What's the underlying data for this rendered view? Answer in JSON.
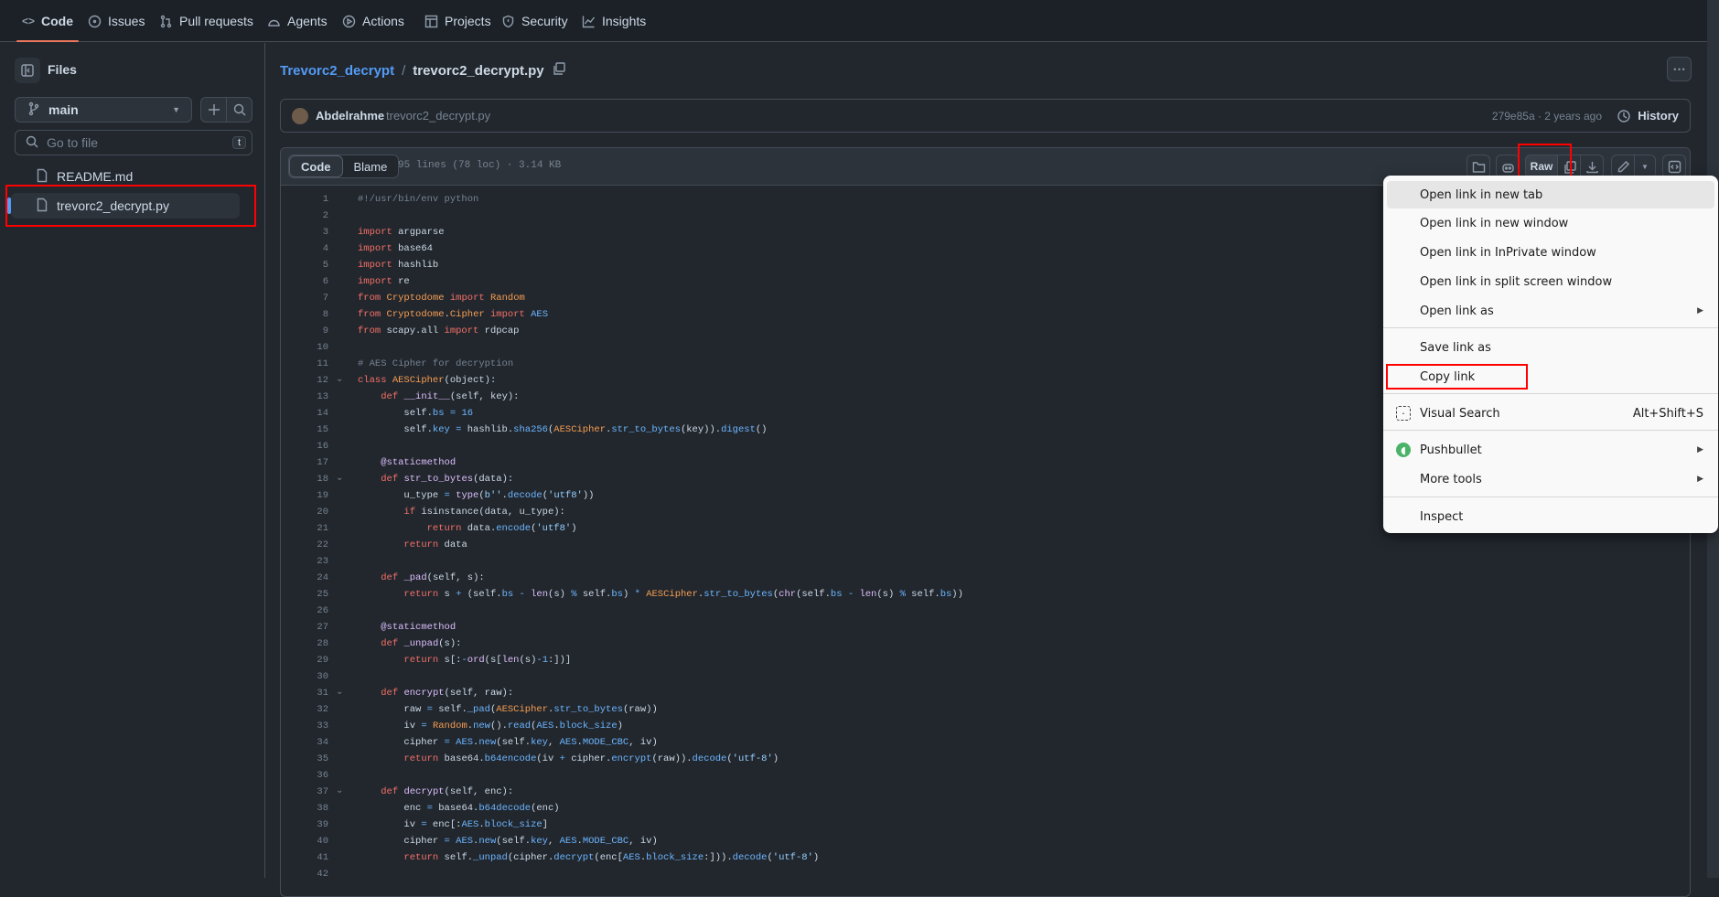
{
  "nav": {
    "items": [
      "Code",
      "Issues",
      "Pull requests",
      "Agents",
      "Actions",
      "Projects",
      "Security",
      "Insights"
    ],
    "active": "Code"
  },
  "sidebar": {
    "title": "Files",
    "branch": "main",
    "search_placeholder": "Go to file",
    "search_shortcut": "t",
    "files": [
      "README.md",
      "trevorc2_decrypt.py"
    ],
    "selected": "trevorc2_decrypt.py"
  },
  "breadcrumb": {
    "repo": "Trevorc2_decrypt",
    "sep": "/",
    "file": "trevorc2_decrypt.py"
  },
  "commit": {
    "author": "Abdelrahme",
    "message": "trevorc2_decrypt.py",
    "hash_age": "279e85a · 2 years ago",
    "history": "History"
  },
  "file": {
    "tab_code": "Code",
    "tab_blame": "Blame",
    "stats": "95 lines (78 loc) · 3.14 KB",
    "raw": "Raw"
  },
  "code": {
    "folds": [
      12,
      18,
      31,
      37
    ],
    "lines": [
      [
        [
          "c",
          "#!/usr/bin/env python"
        ]
      ],
      [],
      [
        [
          "k",
          "import"
        ],
        [
          "p",
          " argparse"
        ]
      ],
      [
        [
          "k",
          "import"
        ],
        [
          "p",
          " base64"
        ]
      ],
      [
        [
          "k",
          "import"
        ],
        [
          "p",
          " hashlib"
        ]
      ],
      [
        [
          "k",
          "import"
        ],
        [
          "p",
          " re"
        ]
      ],
      [
        [
          "k",
          "from"
        ],
        [
          "p",
          " "
        ],
        [
          "e",
          "Cryptodome"
        ],
        [
          "p",
          " "
        ],
        [
          "k",
          "import"
        ],
        [
          "p",
          " "
        ],
        [
          "e",
          "Random"
        ]
      ],
      [
        [
          "k",
          "from"
        ],
        [
          "p",
          " "
        ],
        [
          "e",
          "Cryptodome"
        ],
        [
          "p",
          "."
        ],
        [
          "e",
          "Cipher"
        ],
        [
          "p",
          " "
        ],
        [
          "k",
          "import"
        ],
        [
          "p",
          " "
        ],
        [
          "b",
          "AES"
        ]
      ],
      [
        [
          "k",
          "from"
        ],
        [
          "p",
          " scapy.all "
        ],
        [
          "k",
          "import"
        ],
        [
          "p",
          " rdpcap"
        ]
      ],
      [],
      [
        [
          "c",
          "# AES Cipher for decryption"
        ]
      ],
      [
        [
          "k",
          "class"
        ],
        [
          "p",
          " "
        ],
        [
          "e",
          "AESCipher"
        ],
        [
          "p",
          "(object):"
        ]
      ],
      [
        [
          "p",
          "    "
        ],
        [
          "k",
          "def"
        ],
        [
          "p",
          " "
        ],
        [
          "f",
          "__init__"
        ],
        [
          "p",
          "(self, key):"
        ]
      ],
      [
        [
          "p",
          "        self."
        ],
        [
          "b",
          "bs"
        ],
        [
          "p",
          " "
        ],
        [
          "b",
          "="
        ],
        [
          "p",
          " "
        ],
        [
          "b",
          "16"
        ]
      ],
      [
        [
          "p",
          "        self."
        ],
        [
          "b",
          "key"
        ],
        [
          "p",
          " "
        ],
        [
          "b",
          "="
        ],
        [
          "p",
          " hashlib."
        ],
        [
          "b",
          "sha256"
        ],
        [
          "p",
          "("
        ],
        [
          "e",
          "AESCipher"
        ],
        [
          "p",
          "."
        ],
        [
          "b",
          "str_to_bytes"
        ],
        [
          "p",
          "(key))."
        ],
        [
          "b",
          "digest"
        ],
        [
          "p",
          "()"
        ]
      ],
      [],
      [
        [
          "p",
          "    "
        ],
        [
          "f",
          "@staticmethod"
        ]
      ],
      [
        [
          "p",
          "    "
        ],
        [
          "k",
          "def"
        ],
        [
          "p",
          " "
        ],
        [
          "f",
          "str_to_bytes"
        ],
        [
          "p",
          "(data):"
        ]
      ],
      [
        [
          "p",
          "        u_type "
        ],
        [
          "b",
          "="
        ],
        [
          "p",
          " "
        ],
        [
          "f",
          "type"
        ],
        [
          "p",
          "("
        ],
        [
          "s",
          "b''"
        ],
        [
          "p",
          "."
        ],
        [
          "b",
          "decode"
        ],
        [
          "p",
          "("
        ],
        [
          "s",
          "'utf8'"
        ],
        [
          "p",
          "))"
        ]
      ],
      [
        [
          "p",
          "        "
        ],
        [
          "k",
          "if"
        ],
        [
          "p",
          " isinstance(data, u_type):"
        ]
      ],
      [
        [
          "p",
          "            "
        ],
        [
          "k",
          "return"
        ],
        [
          "p",
          " data."
        ],
        [
          "b",
          "encode"
        ],
        [
          "p",
          "("
        ],
        [
          "s",
          "'utf8'"
        ],
        [
          "p",
          ")"
        ]
      ],
      [
        [
          "p",
          "        "
        ],
        [
          "k",
          "return"
        ],
        [
          "p",
          " data"
        ]
      ],
      [],
      [
        [
          "p",
          "    "
        ],
        [
          "k",
          "def"
        ],
        [
          "p",
          " "
        ],
        [
          "f",
          "_pad"
        ],
        [
          "p",
          "(self, s):"
        ]
      ],
      [
        [
          "p",
          "        "
        ],
        [
          "k",
          "return"
        ],
        [
          "p",
          " s "
        ],
        [
          "b",
          "+"
        ],
        [
          "p",
          " (self."
        ],
        [
          "b",
          "bs"
        ],
        [
          "p",
          " "
        ],
        [
          "b",
          "-"
        ],
        [
          "p",
          " "
        ],
        [
          "f",
          "len"
        ],
        [
          "p",
          "(s) "
        ],
        [
          "b",
          "%"
        ],
        [
          "p",
          " self."
        ],
        [
          "b",
          "bs"
        ],
        [
          "p",
          ") "
        ],
        [
          "b",
          "*"
        ],
        [
          "p",
          " "
        ],
        [
          "e",
          "AESCipher"
        ],
        [
          "p",
          "."
        ],
        [
          "b",
          "str_to_bytes"
        ],
        [
          "p",
          "("
        ],
        [
          "f",
          "chr"
        ],
        [
          "p",
          "(self."
        ],
        [
          "b",
          "bs"
        ],
        [
          "p",
          " "
        ],
        [
          "b",
          "-"
        ],
        [
          "p",
          " "
        ],
        [
          "f",
          "len"
        ],
        [
          "p",
          "(s) "
        ],
        [
          "b",
          "%"
        ],
        [
          "p",
          " self."
        ],
        [
          "b",
          "bs"
        ],
        [
          "p",
          "))"
        ]
      ],
      [],
      [
        [
          "p",
          "    "
        ],
        [
          "f",
          "@staticmethod"
        ]
      ],
      [
        [
          "p",
          "    "
        ],
        [
          "k",
          "def"
        ],
        [
          "p",
          " "
        ],
        [
          "f",
          "_unpad"
        ],
        [
          "p",
          "(s):"
        ]
      ],
      [
        [
          "p",
          "        "
        ],
        [
          "k",
          "return"
        ],
        [
          "p",
          " s[:"
        ],
        [
          "b",
          "-"
        ],
        [
          "f",
          "ord"
        ],
        [
          "p",
          "(s["
        ],
        [
          "f",
          "len"
        ],
        [
          "p",
          "(s)"
        ],
        [
          "b",
          "-1"
        ],
        [
          "p",
          ":])]"
        ]
      ],
      [],
      [
        [
          "p",
          "    "
        ],
        [
          "k",
          "def"
        ],
        [
          "p",
          " "
        ],
        [
          "f",
          "encrypt"
        ],
        [
          "p",
          "(self, raw):"
        ]
      ],
      [
        [
          "p",
          "        raw "
        ],
        [
          "b",
          "="
        ],
        [
          "p",
          " self."
        ],
        [
          "b",
          "_pad"
        ],
        [
          "p",
          "("
        ],
        [
          "e",
          "AESCipher"
        ],
        [
          "p",
          "."
        ],
        [
          "b",
          "str_to_bytes"
        ],
        [
          "p",
          "(raw))"
        ]
      ],
      [
        [
          "p",
          "        iv "
        ],
        [
          "b",
          "="
        ],
        [
          "p",
          " "
        ],
        [
          "e",
          "Random"
        ],
        [
          "p",
          "."
        ],
        [
          "b",
          "new"
        ],
        [
          "p",
          "()."
        ],
        [
          "b",
          "read"
        ],
        [
          "p",
          "("
        ],
        [
          "b",
          "AES"
        ],
        [
          "p",
          "."
        ],
        [
          "b",
          "block_size"
        ],
        [
          "p",
          ")"
        ]
      ],
      [
        [
          "p",
          "        cipher "
        ],
        [
          "b",
          "="
        ],
        [
          "p",
          " "
        ],
        [
          "b",
          "AES"
        ],
        [
          "p",
          "."
        ],
        [
          "b",
          "new"
        ],
        [
          "p",
          "(self."
        ],
        [
          "b",
          "key"
        ],
        [
          "p",
          ", "
        ],
        [
          "b",
          "AES"
        ],
        [
          "p",
          "."
        ],
        [
          "b",
          "MODE_CBC"
        ],
        [
          "p",
          ", iv)"
        ]
      ],
      [
        [
          "p",
          "        "
        ],
        [
          "k",
          "return"
        ],
        [
          "p",
          " base64."
        ],
        [
          "b",
          "b64encode"
        ],
        [
          "p",
          "(iv "
        ],
        [
          "b",
          "+"
        ],
        [
          "p",
          " cipher."
        ],
        [
          "b",
          "encrypt"
        ],
        [
          "p",
          "(raw))."
        ],
        [
          "b",
          "decode"
        ],
        [
          "p",
          "("
        ],
        [
          "s",
          "'utf-8'"
        ],
        [
          "p",
          ")"
        ]
      ],
      [],
      [
        [
          "p",
          "    "
        ],
        [
          "k",
          "def"
        ],
        [
          "p",
          " "
        ],
        [
          "f",
          "decrypt"
        ],
        [
          "p",
          "(self, enc):"
        ]
      ],
      [
        [
          "p",
          "        enc "
        ],
        [
          "b",
          "="
        ],
        [
          "p",
          " base64."
        ],
        [
          "b",
          "b64decode"
        ],
        [
          "p",
          "(enc)"
        ]
      ],
      [
        [
          "p",
          "        iv "
        ],
        [
          "b",
          "="
        ],
        [
          "p",
          " enc[:"
        ],
        [
          "b",
          "AES"
        ],
        [
          "p",
          "."
        ],
        [
          "b",
          "block_size"
        ],
        [
          "p",
          "]"
        ]
      ],
      [
        [
          "p",
          "        cipher "
        ],
        [
          "b",
          "="
        ],
        [
          "p",
          " "
        ],
        [
          "b",
          "AES"
        ],
        [
          "p",
          "."
        ],
        [
          "b",
          "new"
        ],
        [
          "p",
          "(self."
        ],
        [
          "b",
          "key"
        ],
        [
          "p",
          ", "
        ],
        [
          "b",
          "AES"
        ],
        [
          "p",
          "."
        ],
        [
          "b",
          "MODE_CBC"
        ],
        [
          "p",
          ", iv)"
        ]
      ],
      [
        [
          "p",
          "        "
        ],
        [
          "k",
          "return"
        ],
        [
          "p",
          " self."
        ],
        [
          "b",
          "_unpad"
        ],
        [
          "p",
          "(cipher."
        ],
        [
          "b",
          "decrypt"
        ],
        [
          "p",
          "(enc["
        ],
        [
          "b",
          "AES"
        ],
        [
          "p",
          "."
        ],
        [
          "b",
          "block_size"
        ],
        [
          "p",
          ":]))."
        ],
        [
          "b",
          "decode"
        ],
        [
          "p",
          "("
        ],
        [
          "s",
          "'utf-8'"
        ],
        [
          "p",
          ")"
        ]
      ],
      []
    ]
  },
  "context_menu": {
    "items": [
      {
        "label": "Open link in new tab",
        "hover": true
      },
      {
        "label": "Open link in new window"
      },
      {
        "label": "Open link in InPrivate window"
      },
      {
        "label": "Open link in split screen window"
      },
      {
        "label": "Open link as",
        "submenu": true
      },
      {
        "label": "Save link as"
      },
      {
        "label": "Copy link",
        "highlighted": true
      },
      {
        "label": "Visual Search",
        "shortcut": "Alt+Shift+S",
        "icon": "visual-search-icon"
      },
      {
        "label": "Pushbullet",
        "submenu": true,
        "icon": "pushbullet-icon"
      },
      {
        "label": "More tools",
        "submenu": true
      },
      {
        "label": "Inspect"
      }
    ]
  },
  "colors": {
    "accent": "#ec775c",
    "link": "#539bf5",
    "annotation": "#ff0000"
  }
}
